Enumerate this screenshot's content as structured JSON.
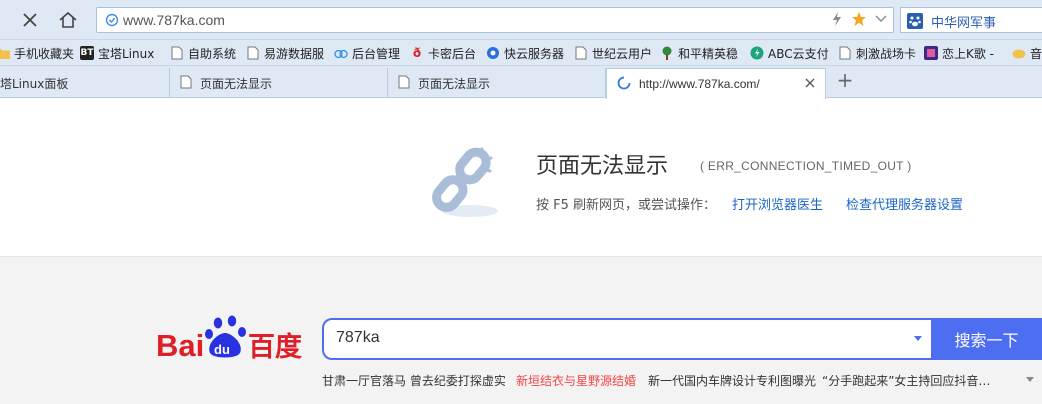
{
  "address_bar": {
    "url": "www.787ka.com",
    "search_engine_label": "中华网军事"
  },
  "bookmarks": [
    {
      "label": "手机收藏夹",
      "icon": "folder-icon"
    },
    {
      "label": "宝塔Linux",
      "icon": "bt-icon"
    },
    {
      "label": "自助系统",
      "icon": "page-icon"
    },
    {
      "label": "易游数据服",
      "icon": "page-icon"
    },
    {
      "label": "后台管理",
      "icon": "cloud-icon"
    },
    {
      "label": "卡密后台",
      "icon": "weibo-icon"
    },
    {
      "label": "快云服务器",
      "icon": "cloud-server-icon"
    },
    {
      "label": "世纪云用户",
      "icon": "page-icon"
    },
    {
      "label": "和平精英稳",
      "icon": "tree-icon"
    },
    {
      "label": "ABC云支付",
      "icon": "pay-icon"
    },
    {
      "label": "刺激战场卡",
      "icon": "page-icon"
    },
    {
      "label": "恋上K歌 -",
      "icon": "ksong-icon"
    },
    {
      "label": "音",
      "icon": "music-icon"
    }
  ],
  "tabs": [
    {
      "label": "塔Linux面板",
      "active": false
    },
    {
      "label": "页面无法显示",
      "active": false
    },
    {
      "label": "页面无法显示",
      "active": false
    },
    {
      "label": "http://www.787ka.com/",
      "active": true
    }
  ],
  "new_tab_label": "+",
  "error": {
    "title": "页面无法显示",
    "code": "( ERR_CONNECTION_TIMED_OUT )",
    "hint": "按 F5 刷新网页，或尝试操作：",
    "link_doctor": "打开浏览器医生",
    "link_proxy": "检查代理服务器设置"
  },
  "baidu": {
    "search_value": "787ka",
    "search_button": "搜索一下",
    "hot_searches": [
      {
        "text": "甘肃一厅官落马 曾去纪委打探虚实",
        "highlight": false
      },
      {
        "text": "新垣结衣与星野源结婚",
        "highlight": true
      },
      {
        "text": "新一代国内车牌设计专利图曝光",
        "highlight": false
      },
      {
        "text": "“分手跑起来”女主持回应抖音…",
        "highlight": false
      }
    ]
  },
  "colors": {
    "chrome_bg": "#dfe9f5",
    "baidu_blue": "#4e6ef2",
    "baidu_red": "#de1f26",
    "link_blue": "#1a66c5",
    "hot_red": "#f54545"
  }
}
